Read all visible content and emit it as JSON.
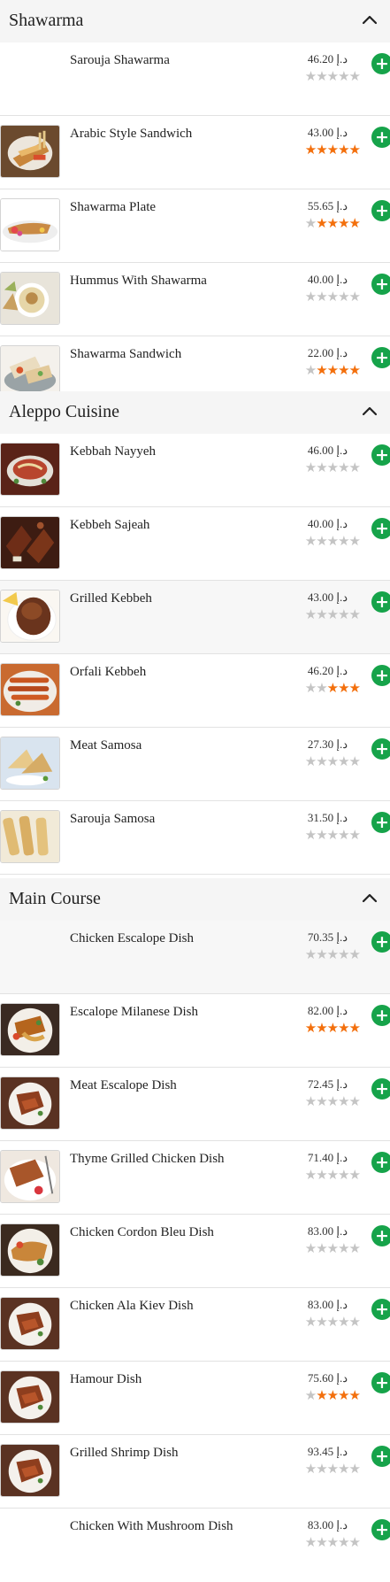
{
  "colors": {
    "accent_green": "#16a34a",
    "star_on": "#f36f0c",
    "star_off": "#c4c4c4",
    "header_bg": "#f5f5f5"
  },
  "icons": {
    "collapse": "chevron-up-icon",
    "add": "plus-icon",
    "rating": "star-icon"
  },
  "add_symbol": "+",
  "star_char": "★",
  "sections": [
    {
      "title": "Shawarma",
      "items": [
        {
          "name": "Sarouja Shawarma",
          "price": "46.20 د.إ",
          "rating": 0,
          "image": "none"
        },
        {
          "name": "Arabic Style Sandwich",
          "price": "43.00 د.إ",
          "rating": 5,
          "image": "sandwich"
        },
        {
          "name": "Shawarma Plate",
          "price": "55.65 د.إ",
          "rating": 4,
          "image": "plate"
        },
        {
          "name": "Hummus With Shawarma",
          "price": "40.00 د.إ",
          "rating": 0,
          "image": "hummus"
        },
        {
          "name": "Shawarma Sandwich",
          "price": "22.00 د.إ",
          "rating": 4,
          "image": "wrap"
        }
      ]
    },
    {
      "title": "Aleppo Cuisine",
      "items": [
        {
          "name": "Kebbah Nayyeh",
          "price": "46.00 د.إ",
          "rating": 0,
          "image": "raw"
        },
        {
          "name": "Kebbeh Sajeah",
          "price": "40.00 د.إ",
          "rating": 0,
          "image": "sajeah"
        },
        {
          "name": "Grilled Kebbeh",
          "price": "43.00 د.إ",
          "rating": 0,
          "image": "grilled"
        },
        {
          "name": "Orfali Kebbeh",
          "price": "46.20 د.إ",
          "rating": 3,
          "image": "skewer"
        },
        {
          "name": "Meat Samosa",
          "price": "27.30 د.إ",
          "rating": 0,
          "image": "samosa"
        },
        {
          "name": "Sarouja Samosa",
          "price": "31.50 د.إ",
          "rating": 0,
          "image": "rolls"
        }
      ]
    },
    {
      "title": "Main Course",
      "items": [
        {
          "name": "Chicken Escalope Dish",
          "price": "70.35 د.إ",
          "rating": 0,
          "image": "none"
        },
        {
          "name": "Escalope Milanese Dish",
          "price": "82.00 د.إ",
          "rating": 5,
          "image": "milanese"
        },
        {
          "name": "Meat Escalope Dish",
          "price": "72.45 د.إ",
          "rating": 0,
          "image": "dish"
        },
        {
          "name": "Thyme Grilled Chicken Dish",
          "price": "71.40 د.إ",
          "rating": 0,
          "image": "thyme"
        },
        {
          "name": "Chicken Cordon Bleu Dish",
          "price": "83.00 د.إ",
          "rating": 0,
          "image": "cordon"
        },
        {
          "name": "Chicken Ala Kiev Dish",
          "price": "83.00 د.إ",
          "rating": 0,
          "image": "dish"
        },
        {
          "name": "Hamour Dish",
          "price": "75.60 د.إ",
          "rating": 4,
          "image": "dish"
        },
        {
          "name": "Grilled Shrimp Dish",
          "price": "93.45 د.إ",
          "rating": 0,
          "image": "dish"
        },
        {
          "name": "Chicken With Mushroom Dish",
          "price": "83.00 د.إ",
          "rating": 0,
          "image": "none"
        }
      ]
    }
  ]
}
